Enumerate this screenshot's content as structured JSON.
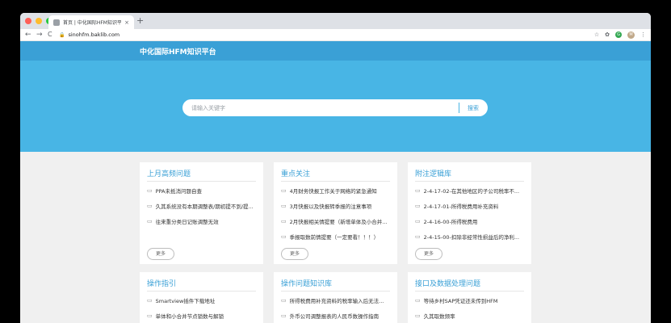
{
  "browser": {
    "tab_title": "首页 | 中化国际HFM知识平台",
    "tab_close": "×",
    "new_tab": "+",
    "back": "←",
    "forward": "→",
    "reload": "C",
    "lock": "🔒",
    "url": "sinohfm.baklib.com",
    "star": "☆",
    "ext_g": "G",
    "avatar": "M",
    "menu": "⋮",
    "traffic_colors": [
      "#ff5f57",
      "#febc2e",
      "#28c840"
    ]
  },
  "site": {
    "title": "中化国际HFM知识平台",
    "search_placeholder": "请输入关键字",
    "search_button": "搜索"
  },
  "cards": [
    {
      "title": "上月高频问题",
      "items": [
        "PPA未抵消问题自查",
        "久其系统没有本期调整表/期初提不到/提...",
        "往来重分类日记账调整无效"
      ],
      "more": "更多"
    },
    {
      "title": "重点关注",
      "items": [
        "4月财务快报工作关于网络的紧急通知",
        "3月快报以及快报转季报的注意事项",
        "2月快报相关情提要（新增单体及小合并抵...",
        "季报取数前情提要（一定要看！！！）"
      ],
      "more": "更多"
    },
    {
      "title": "附注逻辑库",
      "items": [
        "2-4-17-02-在其他地区的子公司税率不...",
        "2-4-17-01-所得税费用补充资料",
        "2-4-16-00-所得税费用",
        "2-4-15-00-扣除非经常性损益后的净利..."
      ],
      "more": "更多"
    },
    {
      "title": "操作指引",
      "items": [
        "Smartview插件下载地址",
        "单体和小合并节点锁数与解锁"
      ]
    },
    {
      "title": "操作问题知识库",
      "items": [
        "所得税费用补充资料的税率输入后无法...",
        "外币公司调整报表的人民币数操作指南"
      ]
    },
    {
      "title": "接口及数据处理问题",
      "items": [
        "等待乡村SAP凭证还未传到HFM",
        "久其取数频率"
      ]
    }
  ]
}
